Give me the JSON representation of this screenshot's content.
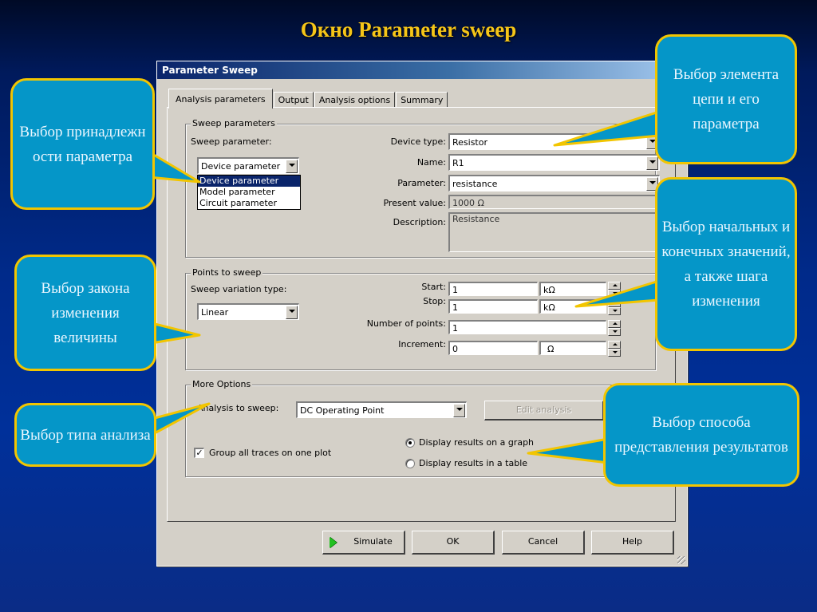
{
  "slide": {
    "title": "Окно Parameter sweep",
    "colors": {
      "title": "#f5c518",
      "callout_fill": "#0596c8",
      "callout_border": "#f2c500"
    }
  },
  "dialog": {
    "title": "Parameter Sweep",
    "tabs": [
      {
        "label": "Analysis parameters",
        "active": true
      },
      {
        "label": "Output",
        "active": false
      },
      {
        "label": "Analysis options",
        "active": false
      },
      {
        "label": "Summary",
        "active": false
      }
    ],
    "sweep_parameters": {
      "group_label": "Sweep parameters",
      "sweep_parameter_label": "Sweep parameter:",
      "sweep_parameter_value": "Device parameter",
      "sweep_parameter_options": [
        "Device parameter",
        "Model parameter",
        "Circuit parameter"
      ],
      "device_type_label": "Device type:",
      "device_type_value": "Resistor",
      "name_label": "Name:",
      "name_value": "R1",
      "parameter_label": "Parameter:",
      "parameter_value": "resistance",
      "present_value_label": "Present value:",
      "present_value": "1000 Ω",
      "description_label": "Description:",
      "description_value": "Resistance"
    },
    "points_to_sweep": {
      "group_label": "Points to sweep",
      "variation_type_label": "Sweep variation type:",
      "variation_type_value": "Linear",
      "start_label": "Start:",
      "start_value": "1",
      "start_unit": "kΩ",
      "stop_label": "Stop:",
      "stop_value": "1",
      "stop_unit": "kΩ",
      "num_points_label": "Number of points:",
      "num_points_value": "1",
      "increment_label": "Increment:",
      "increment_value": "0",
      "increment_unit": "Ω"
    },
    "more_options": {
      "group_label": "More Options",
      "analysis_label": "Analysis to sweep:",
      "analysis_value": "DC Operating Point",
      "edit_analysis_label": "Edit analysis",
      "group_traces_label": "Group all traces on one plot",
      "group_traces_checked": true,
      "display_graph_label": "Display results on a graph",
      "display_table_label": "Display results in a table",
      "display_selected": "graph"
    },
    "buttons": {
      "simulate": "Simulate",
      "ok": "OK",
      "cancel": "Cancel",
      "help": "Help"
    }
  },
  "callouts": {
    "ownership": "Выбор принадлежн ости параметра",
    "element": "Выбор элемента цепи и его параметра",
    "range": "Выбор начальных и конечных значений, а также шага изменения",
    "law": "Выбор закона изменения величины",
    "analysis_type": "Выбор типа анализа",
    "presentation": "Выбор способа представления результатов"
  }
}
